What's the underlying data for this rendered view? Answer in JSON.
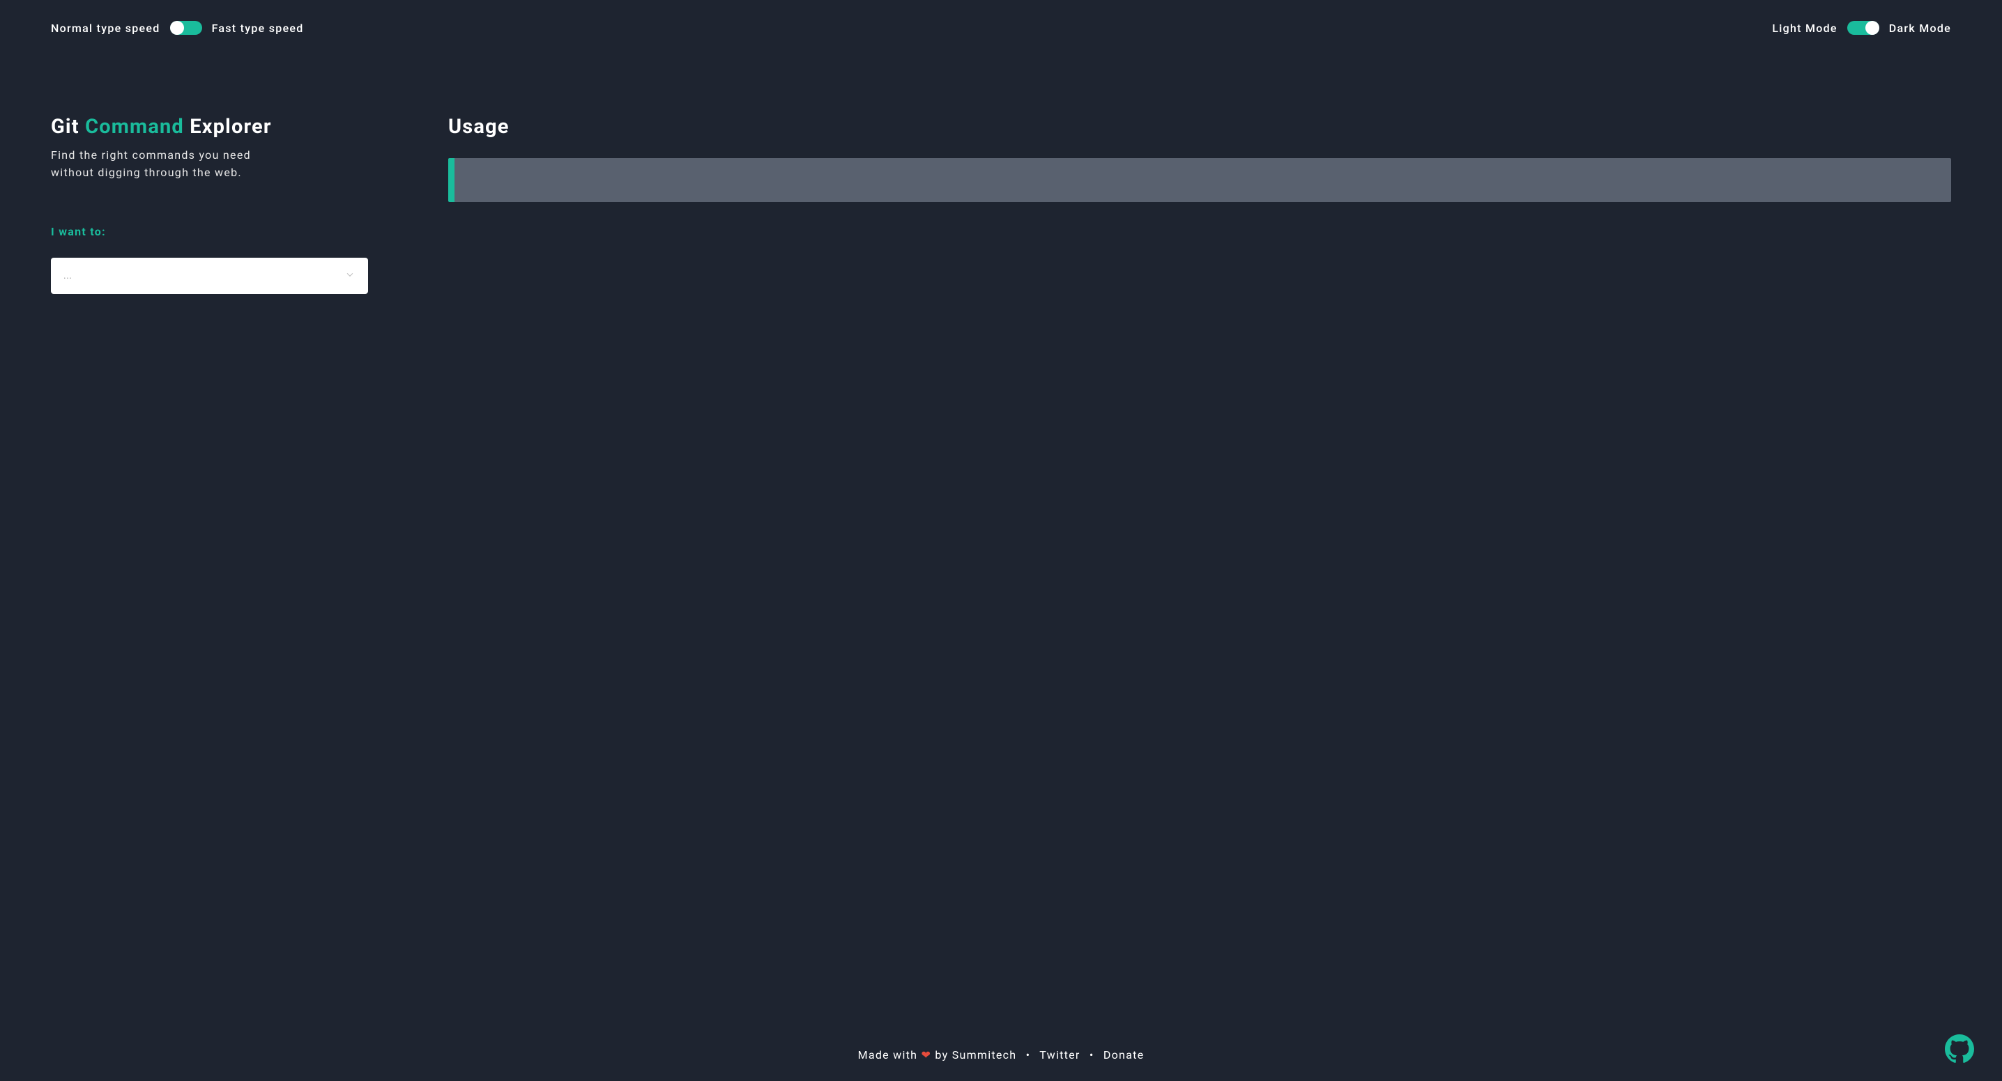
{
  "header": {
    "typeSpeed": {
      "leftLabel": "Normal type speed",
      "rightLabel": "Fast type speed"
    },
    "theme": {
      "leftLabel": "Light Mode",
      "rightLabel": "Dark Mode"
    }
  },
  "main": {
    "title": {
      "part1": "Git ",
      "part2": "Command",
      "part3": " Explorer"
    },
    "subtitle": "Find the right commands you need without digging through the web.",
    "promptLabel": "I want to:",
    "selectPlaceholder": "...",
    "usageTitle": "Usage"
  },
  "footer": {
    "madeWith": "Made with ",
    "heart": "❤",
    "by": " by ",
    "author": "Summitech",
    "twitter": "Twitter",
    "donate": "Donate",
    "sep": "•"
  }
}
